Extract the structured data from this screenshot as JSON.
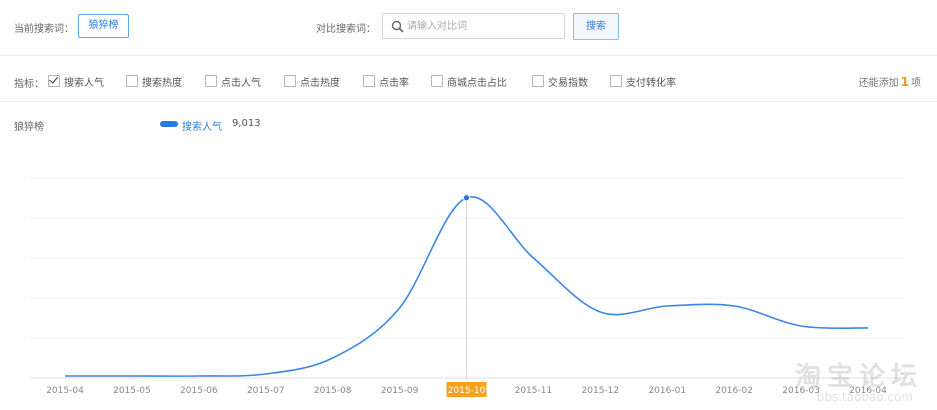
{
  "header": {
    "current_keyword_label": "当前搜索词：",
    "current_keyword": "狼猝榜",
    "compare_label": "对比搜索词：",
    "compare_placeholder": "请输入对比词",
    "search_button": "搜索"
  },
  "metrics": {
    "label": "指标：",
    "items": [
      {
        "label": "搜索人气",
        "checked": true
      },
      {
        "label": "搜索热度",
        "checked": false
      },
      {
        "label": "点击人气",
        "checked": false
      },
      {
        "label": "点击热度",
        "checked": false
      },
      {
        "label": "点击率",
        "checked": false
      },
      {
        "label": "商城点击占比",
        "checked": false
      },
      {
        "label": "交易指数",
        "checked": false
      },
      {
        "label": "支付转化率",
        "checked": false
      }
    ],
    "extra_prefix": "还能添加",
    "extra_count": "1",
    "extra_suffix": "项"
  },
  "legend": {
    "keyword": "狼猝榜",
    "series_name": "搜索人气",
    "series_value": "9,013"
  },
  "colors": {
    "accent": "#2d7fd6",
    "line": "#3c86e6",
    "highlight": "#f5a31a"
  },
  "chart_data": {
    "type": "line",
    "categories": [
      "2015-04",
      "2015-05",
      "2015-06",
      "2015-07",
      "2015-08",
      "2015-09",
      "2015-10",
      "2015-11",
      "2015-12",
      "2016-01",
      "2016-02",
      "2016-03",
      "2016-04"
    ],
    "series": [
      {
        "name": "搜索人气",
        "values": [
          100,
          100,
          100,
          200,
          1000,
          3500,
          9013,
          6000,
          3300,
          3600,
          3600,
          2600,
          2500
        ]
      }
    ],
    "highlight_category": "2015-10",
    "highlight_value": 9013,
    "ylim": [
      0,
      10000
    ],
    "grid": true,
    "legend_position": "top-left"
  },
  "watermark": {
    "text": "淘宝论坛",
    "url": "bbs.taobao.com"
  }
}
